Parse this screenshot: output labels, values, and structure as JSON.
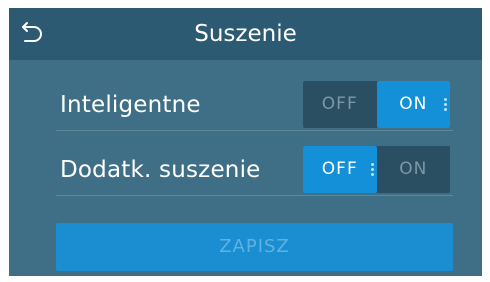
{
  "header": {
    "title": "Suszenie",
    "back_icon": "back-arrow-icon"
  },
  "settings": [
    {
      "label": "Inteligentne",
      "off_label": "OFF",
      "on_label": "ON",
      "value": "ON"
    },
    {
      "label": "Dodatk. suszenie",
      "off_label": "OFF",
      "on_label": "ON",
      "value": "OFF"
    }
  ],
  "save_button": {
    "label": "ZAPISZ",
    "enabled": false
  },
  "colors": {
    "background": "#3f6f86",
    "header": "#2c5a72",
    "toggle_track": "#2a4f62",
    "accent": "#1490d8",
    "text": "#ffffff",
    "inactive_text": "#7d97a4"
  }
}
